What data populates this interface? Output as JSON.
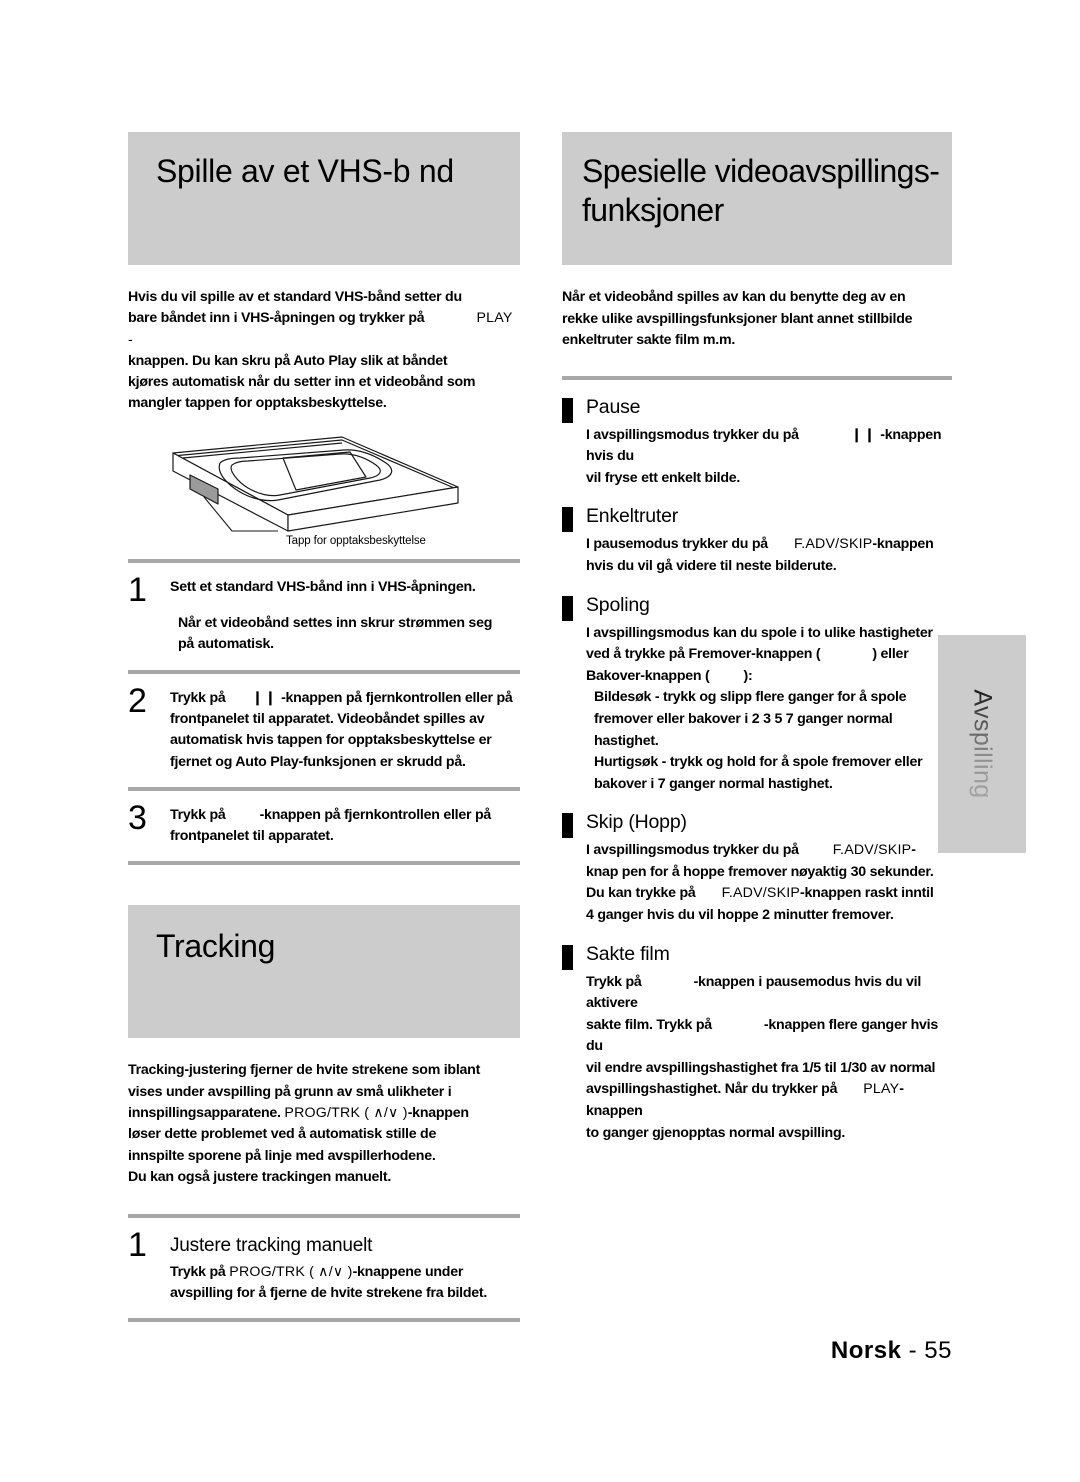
{
  "page": {
    "footer_language": "Norsk",
    "footer_separator": "-",
    "footer_page_number": "55",
    "side_tab_label": "Avspilling",
    "band_color": "#cccccc",
    "rule_color": "#a8a8a8"
  },
  "left_column": {
    "chapter_title": "Spille av et VHS-b nd",
    "intro": "Hvis du vil spille av et standard VHS-bånd  setter du\nbare båndet inn i VHS-åpningen og trykker på        PLAY -\nknappen. Du kan skru på Auto Play  slik at båndet\nkjøres automatisk når du setter inn et videobånd som\nmangler tappen for opptaksbeskyttelse.",
    "intro_lines": [
      "Hvis du vil spille av et standard VHS-bånd  setter du",
      "bare båndet inn i VHS-åpningen og trykker på",
      "PLAY -",
      "knappen. Du kan skru på Auto Play  slik at båndet",
      "kjøres automatisk når du setter inn et videobånd som",
      "mangler tappen for opptaksbeskyttelse."
    ],
    "illustration": {
      "name": "vhs-cassette-diagram",
      "caption": "Tapp for opptaksbeskyttelse"
    },
    "steps": [
      {
        "number": "1",
        "text": "Sett et standard VHS-bånd inn i VHS-åpningen.",
        "subtext": "Når et videobånd settes inn  skrur strømmen seg\n på automatisk."
      },
      {
        "number": "2",
        "text_before": "Trykk på",
        "glyph": "❙❙",
        "text_after": "-knappen på fjernkontrollen eller på\nfrontpanelet til apparatet. Videobåndet spilles av\nautomatisk hvis tappen for opptaksbeskyttelse er\nfjernet og Auto Play-funksjonen er skrudd på."
      },
      {
        "number": "3",
        "text_before": "Trykk på",
        "glyph": "",
        "text_after": "-knappen på fjernkontrollen eller på\nfrontpanelet til apparatet."
      }
    ],
    "tracking_title": "Tracking",
    "tracking_intro_a": "Tracking-justering fjerner de hvite strekene som iblant\nvises under avspilling på grunn av små ulikheter i\ninnspillingsapparatene.",
    "tracking_intro_btn": "PROG/TRK ( ∧/∨ )",
    "tracking_intro_b": "-knappen\nløser dette problemet ved å automatisk stille de\ninnspilte sporene på linje med avspillerhodene.\nDu kan også justere trackingen manuelt.",
    "tracking_step": {
      "number": "1",
      "heading": "Justere tracking manuelt",
      "text_before": "Trykk på",
      "button": "PROG/TRK ( ∧/∨ )",
      "text_after": "-knappene under\navspilling for å fjerne de hvite strekene fra bildet."
    }
  },
  "right_column": {
    "chapter_title": "Spesielle videoavspillings-\nfunksjoner",
    "intro": "Når et videobånd spilles av kan du benytte deg av en\nrekke ulike avspillingsfunksjoner  blant annet stillbilde\nenkeltruter  sakte film  m.m.",
    "features": [
      {
        "title": "Pause",
        "text_before": "I avspillingsmodus trykker du på",
        "glyph": "❙❙",
        "text_after": "-knappen hvis du\nvil fryse ett enkelt bilde."
      },
      {
        "title": "Enkeltruter",
        "text_before": "I pausemodus trykker du på",
        "button": "F.ADV/SKIP",
        "text_after": "-knappen\nhvis du vil gå videre til neste bilderute."
      },
      {
        "title": "Spoling",
        "text_line1": "I avspillingsmodus kan du spole i to ulike hastigheter",
        "text_line2_a": "ved å trykke på Fremover-knappen (",
        "text_line2_b": ") eller",
        "text_line3_a": "Bakover-knappen (",
        "text_line3_b": "):",
        "bullets": [
          "Bildesøk - trykk og slipp flere ganger for å spole\n  fremover eller bakover i 2 3 5 7 ganger normal\n  hastighet.",
          "Hurtigsøk - trykk og hold for å spole fremover eller\n  bakover i 7 ganger normal hastighet."
        ]
      },
      {
        "title": "Skip (Hopp)",
        "text_before": "I avspillingsmodus trykker du på",
        "button": "F.ADV/SKIP",
        "text_mid": "-\nknap pen for å hoppe fremover nøyaktig 30 sekunder.\nDu kan trykke på",
        "button2": "F.ADV/SKIP",
        "text_after": "-knappen raskt inntil\n4 ganger hvis du vil hoppe 2 minutter fremover."
      },
      {
        "title": "Sakte film",
        "text_before": "Trykk på",
        "text_mid1": "-knappen i pausemodus hvis du vil aktivere\nsakte film. Trykk på",
        "text_mid2": "-knappen flere ganger hvis du\nvil endre avspillingshastighet fra 1/5 til 1/30 av normal\navspillingshastighet. Når du trykker på",
        "button": "PLAY",
        "text_after": "-knappen\nto ganger  gjenopptas normal avspilling."
      }
    ]
  }
}
